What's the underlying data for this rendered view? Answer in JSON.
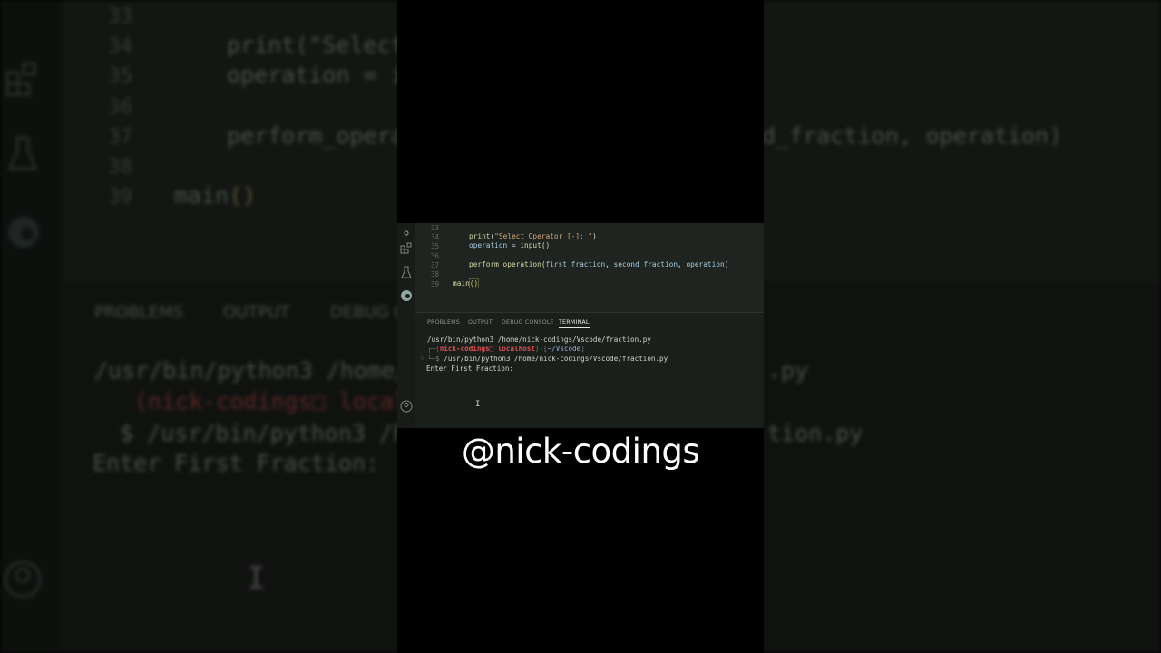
{
  "editor": {
    "line_numbers": [
      "33",
      "34",
      "35",
      "36",
      "37",
      "38",
      "39"
    ],
    "lines": {
      "l34_fn": "print",
      "l34_str": "\"Select Operator [-]: \"",
      "l35_var": "operation",
      "l35_rest": " = ",
      "l35_fn": "input",
      "l37_fn": "perform_operation",
      "l37_arg1": "first_fraction",
      "l37_arg2": "second_fraction",
      "l37_arg3": "operation",
      "l39_fn": "main",
      "l39_parens": "()"
    }
  },
  "panel": {
    "tabs": [
      "PROBLEMS",
      "OUTPUT",
      "DEBUG CONSOLE",
      "TERMINAL"
    ],
    "active_tab": "TERMINAL"
  },
  "terminal": {
    "line1": "/usr/bin/python3 /home/nick-codings/Vscode/fraction.py",
    "prompt_user": "nick-codings",
    "prompt_host": "localhost",
    "prompt_dir": "~/Vscode",
    "line3": "/usr/bin/python3 /home/nick-codings/Vscode/fraction.py",
    "line4": "Enter First Fraction:"
  },
  "background": {
    "bg_print": "print(\"Select",
    "bg_operation": "operation = i",
    "bg_perform": "perform_opera",
    "bg_fraction": "d_fraction, operation)",
    "bg_main": "main",
    "bg_tab1": "PROBLEMS",
    "bg_tab2": "OUTPUT",
    "bg_tab3": "DEBUG C",
    "bg_cmd": "/usr/bin/python3 /home/n",
    "bg_prompt": "(nick-codings□ localh",
    "bg_cmd2": "$ /usr/bin/python3 /ho",
    "bg_enter": "Enter First Fraction:",
    "bg_py1": ".py",
    "bg_py2": "tion.py"
  },
  "watermark": "@nick-codings",
  "colors": {
    "accent_red": "#e05050",
    "watermark": "#ffffff"
  }
}
